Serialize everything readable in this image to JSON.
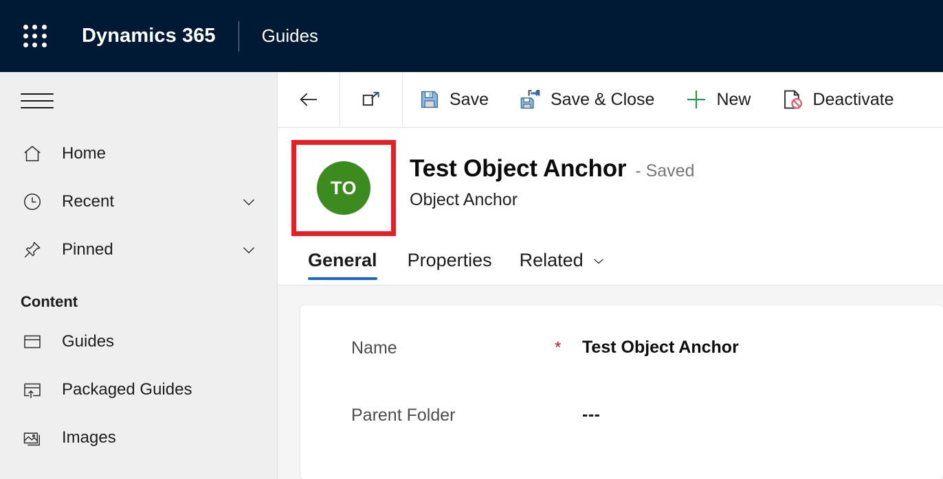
{
  "topbar": {
    "waffle_icon": "app-launcher-grid-icon",
    "brand": "Dynamics 365",
    "app_name": "Guides"
  },
  "sidebar": {
    "menu_icon": "hamburger-menu-icon",
    "items": [
      {
        "label": "Home",
        "icon": "home-icon",
        "chevron": false
      },
      {
        "label": "Recent",
        "icon": "clock-icon",
        "chevron": true
      },
      {
        "label": "Pinned",
        "icon": "pin-icon",
        "chevron": true
      }
    ],
    "section_title": "Content",
    "content_items": [
      {
        "label": "Guides",
        "icon": "window-icon"
      },
      {
        "label": "Packaged Guides",
        "icon": "window-upload-icon"
      },
      {
        "label": "Images",
        "icon": "images-icon"
      }
    ]
  },
  "commandbar": {
    "back_icon": "back-arrow-icon",
    "popout_icon": "open-in-new-window-icon",
    "commands": [
      {
        "label": "Save",
        "icon": "save-floppy-icon"
      },
      {
        "label": "Save & Close",
        "icon": "save-and-close-icon"
      },
      {
        "label": "New",
        "icon": "plus-icon"
      },
      {
        "label": "Deactivate",
        "icon": "deactivate-document-icon"
      }
    ]
  },
  "record": {
    "avatar_initials": "TO",
    "avatar_color": "#3b8b1e",
    "highlight_color": "#ed1c24",
    "title": "Test Object Anchor",
    "state": "- Saved",
    "subtitle": "Object Anchor"
  },
  "tabs": [
    {
      "label": "General",
      "active": true,
      "chevron": false
    },
    {
      "label": "Properties",
      "active": false,
      "chevron": false
    },
    {
      "label": "Related",
      "active": false,
      "chevron": true
    }
  ],
  "form": {
    "fields": [
      {
        "label": "Name",
        "required": true,
        "required_mark": "*",
        "value": "Test Object Anchor"
      },
      {
        "label": "Parent Folder",
        "required": false,
        "required_mark": "",
        "value": "---"
      }
    ]
  }
}
